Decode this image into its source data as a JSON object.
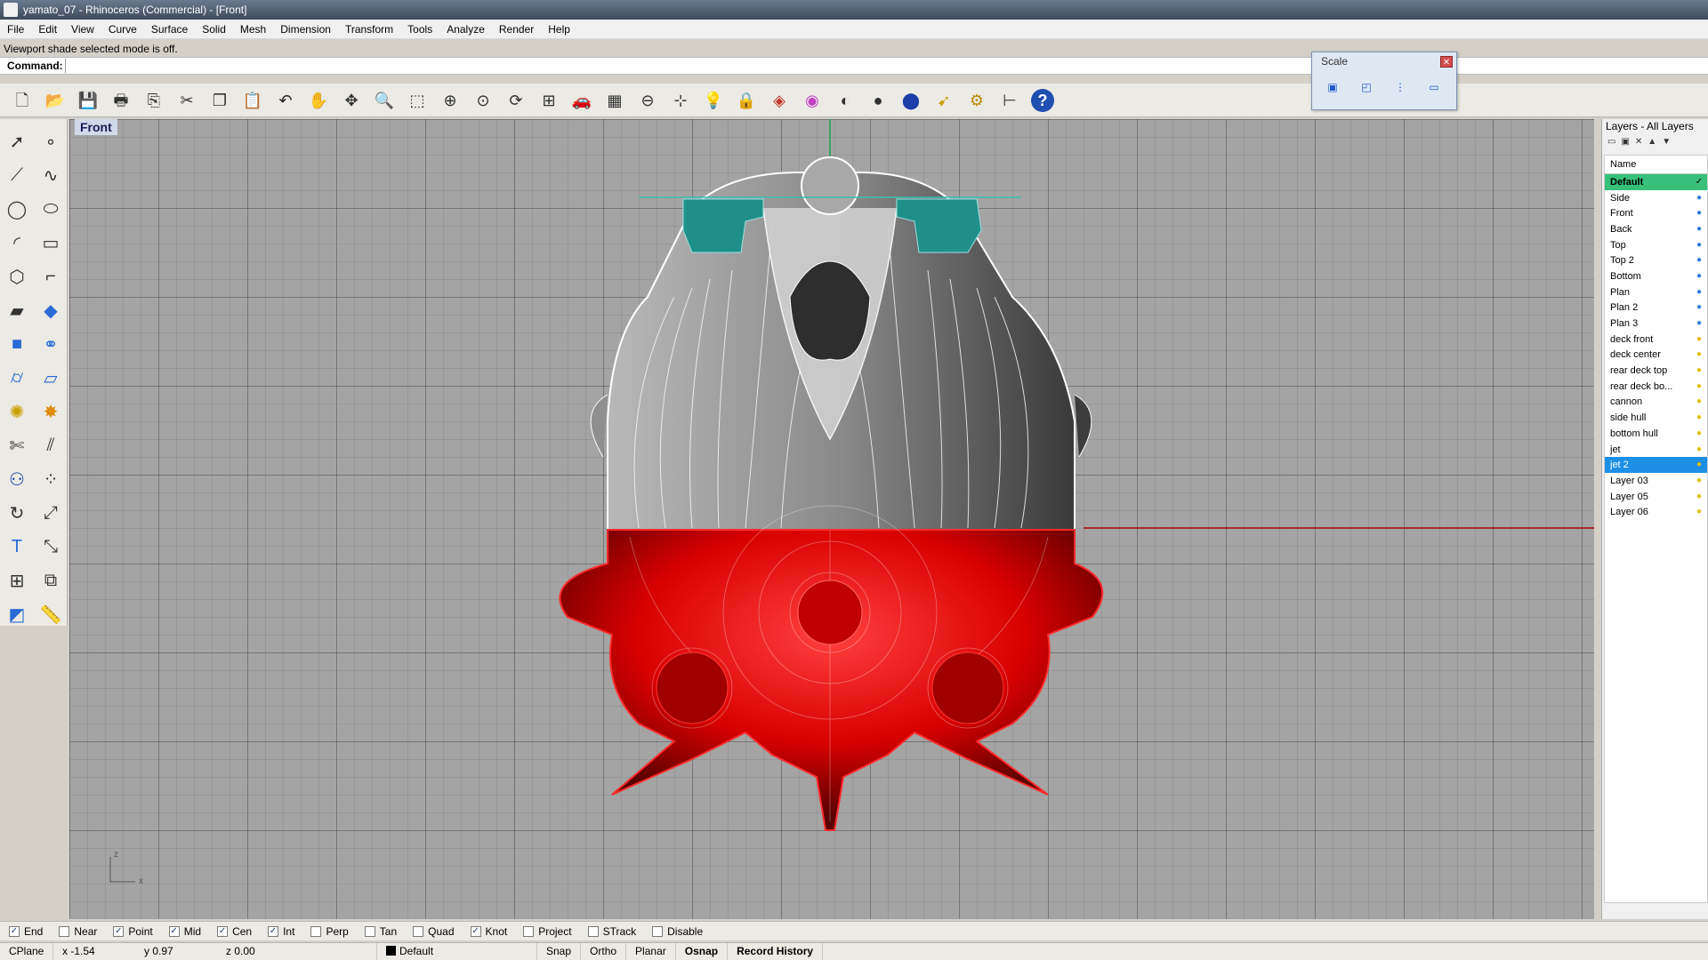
{
  "window": {
    "title": "yamato_07 - Rhinoceros (Commercial) - [Front]"
  },
  "menu": [
    "File",
    "Edit",
    "View",
    "Curve",
    "Surface",
    "Solid",
    "Mesh",
    "Dimension",
    "Transform",
    "Tools",
    "Analyze",
    "Render",
    "Help"
  ],
  "command": {
    "history": "Viewport shade selected mode is off.",
    "label": "Command:",
    "value": ""
  },
  "toolbar": {
    "icons": [
      "new-file-icon",
      "open-file-icon",
      "save-icon",
      "print-icon",
      "import-icon",
      "cut-icon",
      "copy-icon",
      "paste-icon",
      "undo-icon",
      "pan-hand-icon",
      "move-view-icon",
      "zoom-icon",
      "zoom-window-icon",
      "zoom-extents-icon",
      "zoom-selected-icon",
      "rotate-view-icon",
      "four-viewports-icon",
      "car-icon",
      "grid-plane-icon",
      "cplane-icon",
      "osnap-icon",
      "light-bulb-icon",
      "lock-icon",
      "layer-icon",
      "color-wheel-icon",
      "shaded-sphere-icon",
      "rendered-sphere-icon",
      "blue-sphere-icon",
      "select-icon",
      "options-gear-icon",
      "dimension-icon",
      "help-icon"
    ]
  },
  "scale_panel": {
    "title": "Scale",
    "icons": [
      "scale-3d-icon",
      "scale-2d-icon",
      "scale-1d-icon",
      "scale-nu-icon"
    ]
  },
  "left_toolbar": {
    "icons": [
      "select-arrow-icon",
      "point-icon",
      "polyline-icon",
      "curve-icon",
      "circle-icon",
      "ellipse-icon",
      "arc-icon",
      "rectangle-icon",
      "polygon-icon",
      "fillet-curve-icon",
      "surface-icon",
      "extrude-surface-icon",
      "box-solid-icon",
      "boolean-spheres-icon",
      "cylinder-icon",
      "plane-surface-icon",
      "transform-gear-icon",
      "explode-icon",
      "trim-icon",
      "split-icon",
      "boolean-union-icon",
      "points-cloud-icon",
      "rotate-icon",
      "scale-icon",
      "text-icon",
      "move-icon",
      "array-icon",
      "block-icon",
      "render-box-icon",
      "ruler-icon"
    ]
  },
  "viewport": {
    "title": "Front",
    "axis_z": "z",
    "axis_x": "x",
    "colors": {
      "hull_red": "#e00000",
      "wire_white": "#ffffff",
      "accent_teal": "#1f8f8a",
      "background": "#a4a4a4"
    }
  },
  "layers": {
    "title": "Layers - All Layers",
    "column_name": "Name",
    "rows": [
      {
        "name": "Default",
        "state": "current",
        "bulb": "check"
      },
      {
        "name": "Side",
        "state": "",
        "bulb": "blue"
      },
      {
        "name": "Front",
        "state": "",
        "bulb": "blue"
      },
      {
        "name": "Back",
        "state": "",
        "bulb": "blue"
      },
      {
        "name": "Top",
        "state": "",
        "bulb": "blue"
      },
      {
        "name": "Top 2",
        "state": "",
        "bulb": "blue"
      },
      {
        "name": "Bottom",
        "state": "",
        "bulb": "blue"
      },
      {
        "name": "Plan",
        "state": "",
        "bulb": "blue"
      },
      {
        "name": "Plan 2",
        "state": "",
        "bulb": "blue"
      },
      {
        "name": "Plan 3",
        "state": "",
        "bulb": "blue"
      },
      {
        "name": "deck front",
        "state": "",
        "bulb": "yellow"
      },
      {
        "name": "deck center",
        "state": "",
        "bulb": "yellow"
      },
      {
        "name": "rear deck top",
        "state": "",
        "bulb": "yellow"
      },
      {
        "name": "rear deck bo...",
        "state": "",
        "bulb": "yellow"
      },
      {
        "name": "cannon",
        "state": "",
        "bulb": "yellow"
      },
      {
        "name": "side hull",
        "state": "",
        "bulb": "yellow"
      },
      {
        "name": "bottom hull",
        "state": "",
        "bulb": "yellow"
      },
      {
        "name": "jet",
        "state": "",
        "bulb": "yellow"
      },
      {
        "name": "jet 2",
        "state": "selected",
        "bulb": "yellow"
      },
      {
        "name": "Layer 03",
        "state": "",
        "bulb": "yellow"
      },
      {
        "name": "Layer 05",
        "state": "",
        "bulb": "yellow"
      },
      {
        "name": "Layer 06",
        "state": "",
        "bulb": "yellow"
      }
    ]
  },
  "osnap": [
    {
      "label": "End",
      "checked": true
    },
    {
      "label": "Near",
      "checked": false
    },
    {
      "label": "Point",
      "checked": true
    },
    {
      "label": "Mid",
      "checked": true
    },
    {
      "label": "Cen",
      "checked": true
    },
    {
      "label": "Int",
      "checked": true
    },
    {
      "label": "Perp",
      "checked": false
    },
    {
      "label": "Tan",
      "checked": false
    },
    {
      "label": "Quad",
      "checked": false
    },
    {
      "label": "Knot",
      "checked": true
    },
    {
      "label": "Project",
      "checked": false
    },
    {
      "label": "STrack",
      "checked": false
    },
    {
      "label": "Disable",
      "checked": false
    }
  ],
  "status": {
    "cplane": "CPlane",
    "x": "x -1.54",
    "y": "y 0.97",
    "z": "z 0.00",
    "layer": "Default",
    "snap": "Snap",
    "ortho": "Ortho",
    "planar": "Planar",
    "osnap": "Osnap",
    "record_history": "Record History"
  }
}
